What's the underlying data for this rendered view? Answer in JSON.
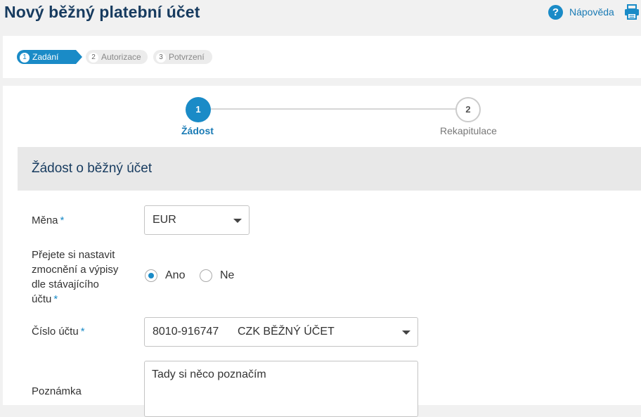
{
  "header": {
    "title": "Nový běžný platební účet",
    "help_label": "Nápověda"
  },
  "wizard": {
    "steps": [
      {
        "num": "1",
        "label": "Zadání"
      },
      {
        "num": "2",
        "label": "Autorizace"
      },
      {
        "num": "3",
        "label": "Potvrzení"
      }
    ],
    "active_step": 1
  },
  "stepper": {
    "steps": [
      {
        "num": "1",
        "label": "Žádost"
      },
      {
        "num": "2",
        "label": "Rekapitulace"
      }
    ]
  },
  "section": {
    "title": "Žádost o běžný účet"
  },
  "form": {
    "currency_label": "Měna",
    "currency_value": "EUR",
    "required_mark": "*",
    "settings_label_lines": [
      "Přejete si nastavit",
      "zmocnění a výpisy",
      "dle stávajícího",
      "účtu"
    ],
    "radio_yes": "Ano",
    "radio_no": "Ne",
    "radio_selected": "Ano",
    "account_label": "Číslo účtu",
    "account_value": "8010-916747      CZK BĚŽNÝ ÚČET",
    "note_label": "Poznámka",
    "note_value": "Tady si něco poznačím"
  },
  "colors": {
    "accent": "#1a8bc7",
    "title": "#173b5f"
  }
}
